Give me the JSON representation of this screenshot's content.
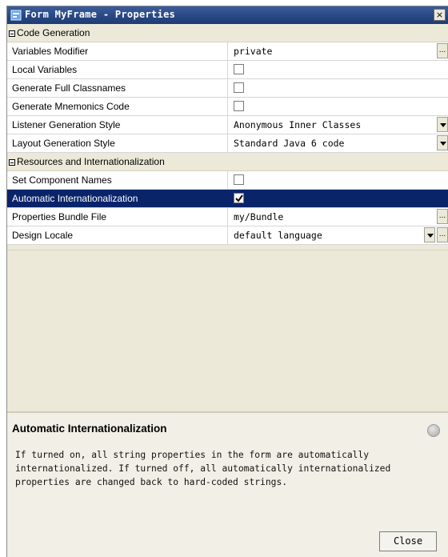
{
  "window": {
    "title": "Form MyFrame - Properties",
    "close_glyph": "×"
  },
  "sections": [
    {
      "label": "Code Generation",
      "properties": [
        {
          "name": "Variables Modifier",
          "value": "private",
          "editor": "text-ellipsis"
        },
        {
          "name": "Local Variables",
          "value": "",
          "editor": "checkbox",
          "checked": false
        },
        {
          "name": "Generate Full Classnames",
          "value": "",
          "editor": "checkbox",
          "checked": false
        },
        {
          "name": "Generate Mnemonics Code",
          "value": "",
          "editor": "checkbox",
          "checked": false
        },
        {
          "name": "Listener Generation Style",
          "value": "Anonymous Inner Classes",
          "editor": "dropdown"
        },
        {
          "name": "Layout Generation Style",
          "value": "Standard Java 6 code",
          "editor": "dropdown"
        }
      ]
    },
    {
      "label": "Resources and Internationalization",
      "properties": [
        {
          "name": "Set Component Names",
          "value": "",
          "editor": "checkbox",
          "checked": false
        },
        {
          "name": "Automatic Internationalization",
          "value": "",
          "editor": "checkbox",
          "checked": true,
          "selected": true
        },
        {
          "name": "Properties Bundle File",
          "value": "my/Bundle",
          "editor": "text-ellipsis"
        },
        {
          "name": "Design Locale",
          "value": "default language",
          "editor": "dropdown-ellipsis"
        }
      ]
    }
  ],
  "description": {
    "title": "Automatic Internationalization",
    "text": "If turned on, all string properties in the form are automatically\ninternationalized. If turned off, all automatically internationalized\nproperties are changed back to hard-coded strings."
  },
  "buttons": {
    "close_label": "Close",
    "ellipsis_label": "..."
  },
  "colors": {
    "selection": "#0a246a",
    "titlebar": "#2a4a86",
    "panel": "#ece9d8"
  }
}
